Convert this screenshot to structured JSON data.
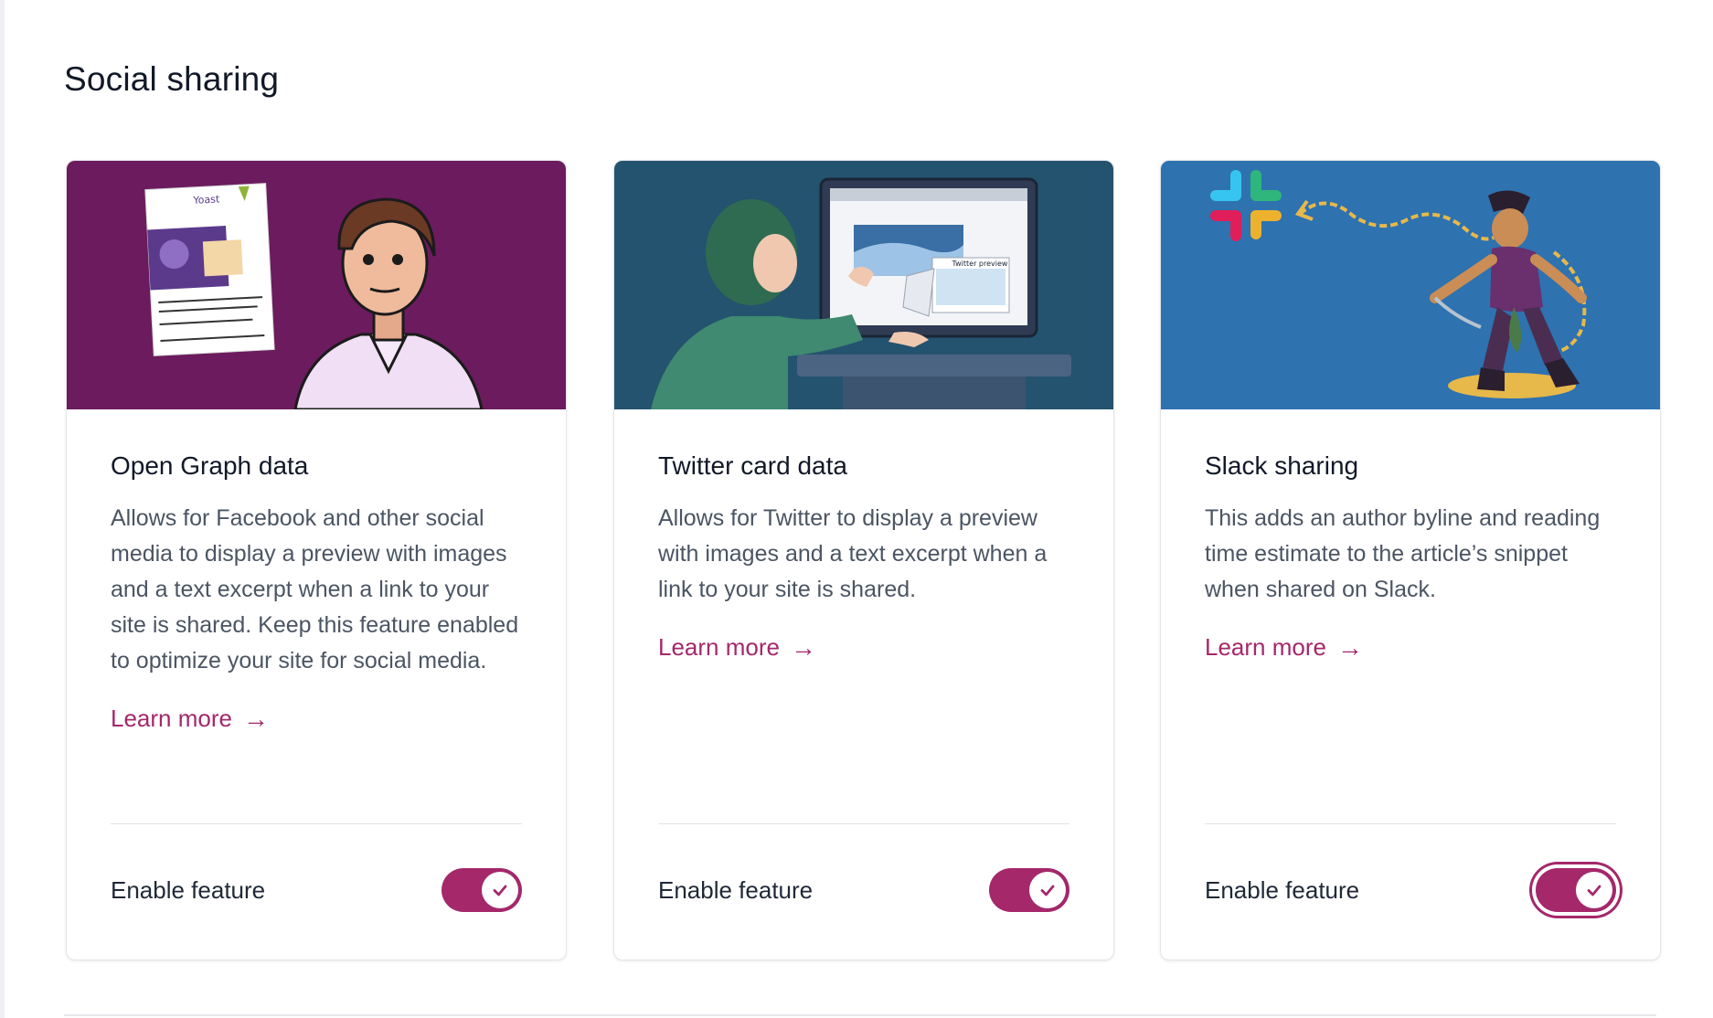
{
  "section": {
    "title": "Social sharing"
  },
  "colors": {
    "accent": "#a4286a",
    "og_bg": "#6b1b5e",
    "twitter_bg": "#24536f",
    "slack_bg": "#2e72b0"
  },
  "cards": [
    {
      "title": "Open Graph data",
      "description": "Allows for Facebook and other social media to display a preview with images and a text excerpt when a link to your site is shared. Keep this feature enabled to optimize your site for social media.",
      "learn_more": "Learn more",
      "arrow": "→",
      "enable_label": "Enable feature",
      "enabled": true,
      "illustration": "man-reading-facebook-preview",
      "yoast_label": "Yoast"
    },
    {
      "title": "Twitter card data",
      "description": "Allows for Twitter to display a preview with images and a text excerpt when a link to your site is shared.",
      "learn_more": "Learn more",
      "arrow": "→",
      "enable_label": "Enable feature",
      "enabled": true,
      "illustration": "person-peeling-browser-page",
      "preview_label": "Twitter preview"
    },
    {
      "title": "Slack sharing",
      "description": "This adds an author byline and reading time estimate to the article’s snippet when shared on Slack.",
      "learn_more": "Learn more",
      "arrow": "→",
      "enable_label": "Enable feature",
      "enabled": true,
      "focused": true,
      "illustration": "pirate-with-chain-and-slack-logo"
    }
  ]
}
